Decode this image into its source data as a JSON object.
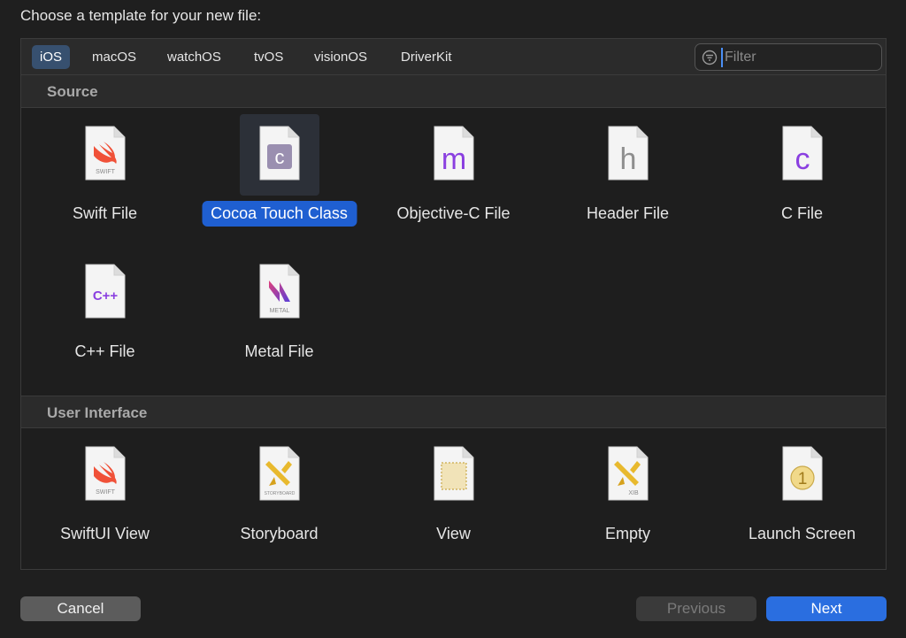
{
  "prompt": "Choose a template for your new file:",
  "tabs": [
    {
      "label": "iOS",
      "selected": true
    },
    {
      "label": "macOS"
    },
    {
      "label": "watchOS"
    },
    {
      "label": "tvOS"
    },
    {
      "label": "visionOS"
    },
    {
      "label": "DriverKit"
    }
  ],
  "filter": {
    "placeholder": "Filter",
    "value": ""
  },
  "sections": {
    "source": {
      "title": "Source",
      "items": [
        {
          "label": "Swift File",
          "icon": "swift-file-icon",
          "badge": "SWIFT"
        },
        {
          "label": "Cocoa Touch Class",
          "icon": "cocoa-touch-class-icon",
          "glyph": "c"
        },
        {
          "label": "Objective-C File",
          "icon": "objective-c-file-icon",
          "glyph": "m"
        },
        {
          "label": "Header File",
          "icon": "header-file-icon",
          "glyph": "h"
        },
        {
          "label": "C File",
          "icon": "c-file-icon",
          "glyph": "c"
        },
        {
          "label": "C++ File",
          "icon": "cpp-file-icon",
          "glyph": "C++"
        },
        {
          "label": "Metal File",
          "icon": "metal-file-icon",
          "badge": "METAL"
        }
      ]
    },
    "ui": {
      "title": "User Interface",
      "items": [
        {
          "label": "SwiftUI View",
          "icon": "swift-file-icon",
          "badge": "SWIFT"
        },
        {
          "label": "Storyboard",
          "icon": "storyboard-icon",
          "badge": "STORYBOARD"
        },
        {
          "label": "View",
          "icon": "view-file-icon"
        },
        {
          "label": "Empty",
          "icon": "xib-file-icon",
          "badge": "XIB"
        },
        {
          "label": "Launch Screen",
          "icon": "launch-screen-icon",
          "glyph": "1"
        }
      ]
    }
  },
  "buttons": {
    "cancel": "Cancel",
    "previous": "Previous",
    "next": "Next"
  },
  "colors": {
    "accent": "#1f5fd1",
    "swift": "#f05138",
    "purple": "#8a3fe0",
    "gray_doc": "#9a8fb0",
    "storyboard": "#e8b92e"
  }
}
